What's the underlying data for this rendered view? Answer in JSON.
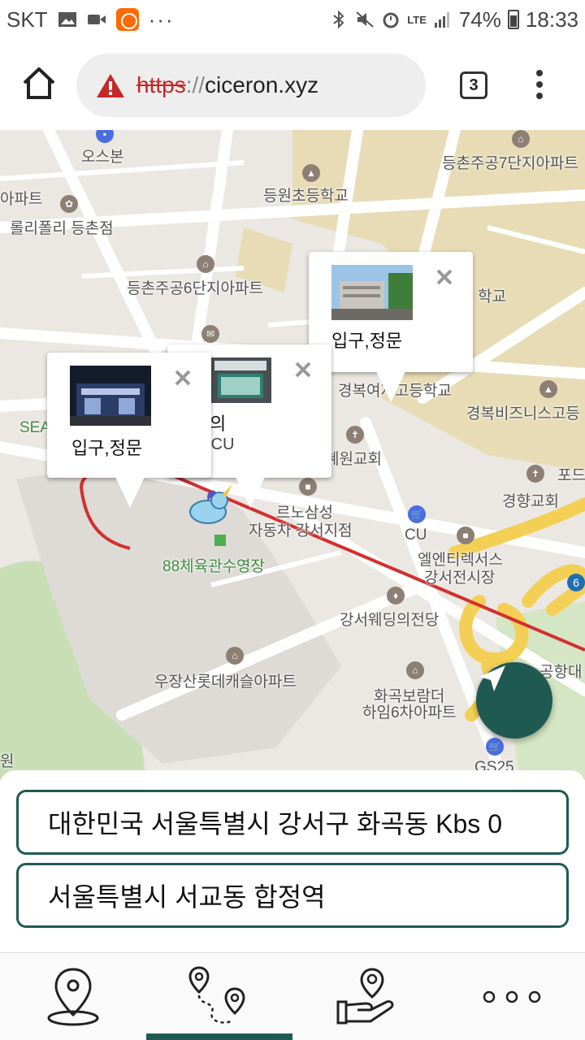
{
  "status_bar": {
    "carrier": "SKT",
    "more": "···",
    "lte": "LTE",
    "battery": "74%",
    "time": "18:33"
  },
  "browser": {
    "url_scheme": "https",
    "url_sep": "://",
    "url_host": "ciceron.xyz",
    "tab_count": "3"
  },
  "map": {
    "labels": {
      "osbon": "오스본",
      "apt_left": "아파트",
      "lollipolly": "롤리폴리 등촌점",
      "deungwon_school": "등원초등학교",
      "deungchon7": "등촌주공7단지아파트",
      "deungchon6": "등촌주공6단지아파트",
      "hakgyo": "학교",
      "gyeongbok_girls": "경복여자고등학교",
      "gyeongbok_biz": "경복비즈니스고등",
      "church_won": "혜원교회",
      "gyeonghyang": "경향교회",
      "pod": "포드",
      "rhino": "르노삼성",
      "rhino2": "자동차 강서지점",
      "cu": "CU",
      "gym": "88체육관수영장",
      "elentech1": "엘엔티렉서스",
      "elentech2": "강서전시장",
      "wedding": "강서웨딩의전당",
      "woojang": "우장산롯데캐슬아파트",
      "hwagok1": "화곡보람더",
      "hwagok2": "하임6차아파트",
      "gonghang": "공항대",
      "gs25": "GS25",
      "sea": "SEA",
      "won": "원",
      "num6": "6"
    },
    "popups": {
      "p1_text": "입구,정문",
      "p2_text": "입구,정문",
      "p3_text1": "의",
      "p3_text2": ",CU"
    }
  },
  "addresses": {
    "start": "대한민국 서울특별시 강서구 화곡동 Kbs 0",
    "dest": "서울특별시 서교동 합정역"
  },
  "colors": {
    "accent": "#1f5a52",
    "route": "#d32f2f",
    "warning": "#c62828"
  },
  "nav": {
    "items": [
      "location-pin-icon",
      "route-icon",
      "hand-pin-icon",
      "more-icon"
    ],
    "active_index": 1
  }
}
